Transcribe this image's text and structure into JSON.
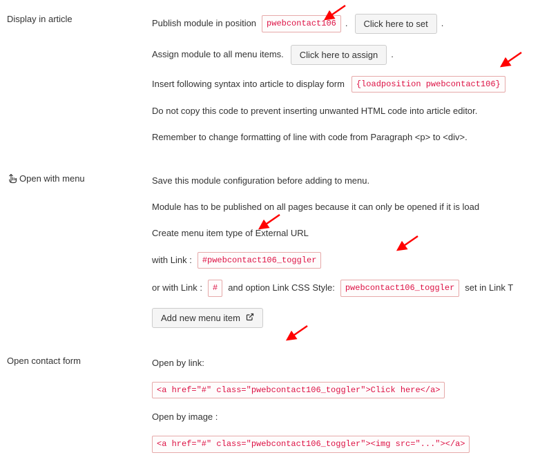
{
  "sections": {
    "display_article": {
      "label": "Display in article",
      "line1_prefix": "Publish module in position",
      "position_code": "pwebcontact106",
      "dot": ".",
      "set_button": "Click here to set",
      "line2_prefix": "Assign module to all menu items.",
      "assign_button": "Click here to assign",
      "line3_prefix": "Insert following syntax into article to display form",
      "syntax_code": "{loadposition pwebcontact106}",
      "line4": "Do not copy this code to prevent inserting unwanted HTML code into article editor.",
      "line5": "Remember to change formatting of line with code from Paragraph <p> to <div>."
    },
    "open_menu": {
      "label": "Open with menu",
      "line1": "Save this module configuration before adding to menu.",
      "line2": "Module has to be published on all pages because it can only be opened if it is load",
      "line3": "Create menu item type of External URL",
      "line4_prefix": "with Link :",
      "link_code1": "#pwebcontact106_toggler",
      "line5_prefix": "or with Link :",
      "hash_code": "#",
      "line5_mid": "and option Link CSS Style:",
      "css_code": "pwebcontact106_toggler",
      "line5_suffix": "set in Link T",
      "add_button": "Add new menu item"
    },
    "open_form": {
      "label": "Open contact form",
      "line1": "Open by link:",
      "link_code": "<a href=\"#\" class=\"pwebcontact106_toggler\">Click here</a>",
      "line2": "Open by image :",
      "img_code": "<a href=\"#\" class=\"pwebcontact106_toggler\"><img src=\"...\"></a>"
    }
  }
}
